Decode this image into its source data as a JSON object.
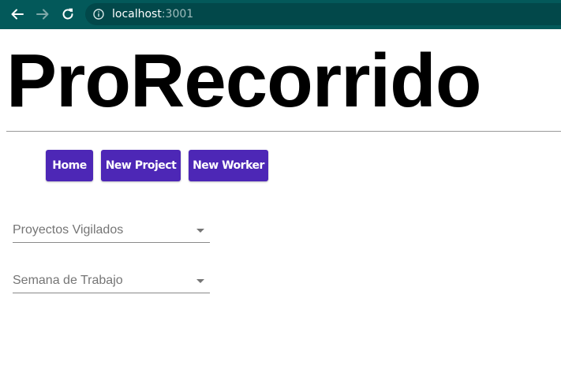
{
  "browser": {
    "url_host": "localhost",
    "url_port": ":3001"
  },
  "page": {
    "title": "ProRecorrido"
  },
  "nav": {
    "home_label": "Home",
    "new_project_label": "New Project",
    "new_worker_label": "New Worker"
  },
  "filters": {
    "projects_label": "Proyectos Vigilados",
    "week_label": "Semana de Trabajo"
  },
  "colors": {
    "chrome": "#03595a",
    "button": "#4d27b6"
  }
}
